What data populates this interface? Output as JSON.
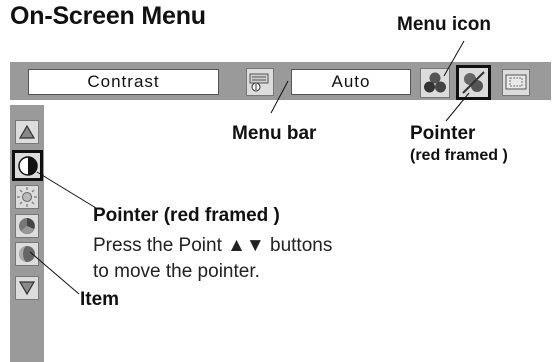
{
  "title": "On-Screen Menu",
  "menu_bar": {
    "contrast_label": "Contrast",
    "auto_label": "Auto",
    "icons": [
      "settings-card-icon",
      "color-balls-icon",
      "color-pointer-icon",
      "screen-icon"
    ]
  },
  "items": [
    "triangle-up-icon",
    "contrast-icon",
    "brightness-sun-icon",
    "color-pie-icon",
    "tint-ball-icon",
    "triangle-down-icon"
  ],
  "callouts": {
    "menu_icon": "Menu icon",
    "menu_bar": "Menu bar",
    "pointer_top_line1": "Pointer",
    "pointer_top_line2": "(red framed )",
    "pointer_left": "Pointer (red framed )",
    "instruction_line1": "Press the Point ▲▼ buttons",
    "instruction_line2": "to move the pointer.",
    "item": "Item"
  },
  "colors": {
    "menu_background": "#9a9a9a",
    "pointer_frame": "#111111"
  }
}
